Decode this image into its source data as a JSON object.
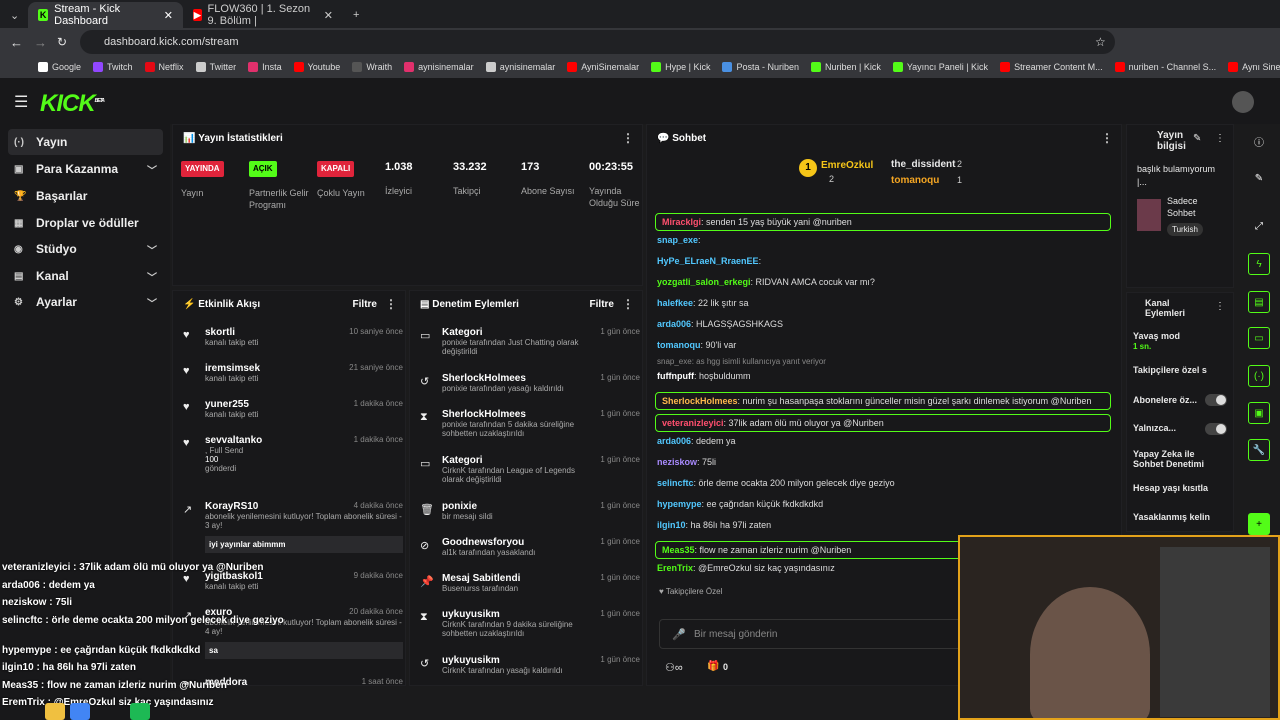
{
  "browser": {
    "tabs": [
      "Stream - Kick Dashboard",
      "FLOW360 | 1. Sezon 9. Bölüm |"
    ],
    "url": "dashboard.kick.com/stream",
    "bookmarks": [
      "Google",
      "Twitch",
      "Netflix",
      "Twitter",
      "Insta",
      "Youtube",
      "Wraith",
      "aynisinemalar",
      "aynisinemalar",
      "AyniSinemalar",
      "Hype | Kick",
      "Posta - Nuriben",
      "Nuriben | Kick",
      "Yayıncı Paneli | Kick",
      "Streamer Content M...",
      "nuriben - Channel S...",
      "Aynı Sinemalar - Ça..."
    ]
  },
  "brand": {
    "logo": "KICK",
    "beta": "BETA"
  },
  "sidebar": [
    "Yayın",
    "Para Kazanma",
    "Başarılar",
    "Droplar ve ödüller",
    "Stüdyo",
    "Kanal",
    "Ayarlar"
  ],
  "stats": {
    "title": "Yayın İstatistikleri",
    "items": [
      {
        "badge": "YAYINDA",
        "label": "Yayın"
      },
      {
        "badge": "AÇIK",
        "label": "Partnerlik Gelir Programı"
      },
      {
        "badge": "KAPALI",
        "label": "Çoklu Yayın"
      },
      {
        "value": "1.038",
        "label": "İzleyici"
      },
      {
        "value": "33.232",
        "label": "Takipçi"
      },
      {
        "value": "173",
        "label": "Abone Sayısı"
      },
      {
        "value": "00:23:55",
        "label": "Yayında Olduğu Süre"
      }
    ]
  },
  "activity": {
    "title": "Etkinlik Akışı",
    "filter": "Filtre",
    "items": [
      {
        "name": "skortli",
        "sub": "kanalı takip etti",
        "time": "10 saniye önce"
      },
      {
        "name": "iremsimsek",
        "sub": "kanalı takip etti",
        "time": "21 saniye önce"
      },
      {
        "name": "yuner255",
        "sub": "kanalı takip etti",
        "time": "1 dakika önce"
      },
      {
        "name": "sevvaltanko",
        "sub": ", Full Send",
        "extra": "100",
        "sub2": "gönderdi",
        "time": "1 dakika önce"
      },
      {
        "name": "KorayRS10",
        "sub": "abonelik yenilemesini kutluyor! Toplam abonelik süresi - 3 ay!",
        "msg": "iyi yayınlar abimmm",
        "time": "4 dakika önce"
      },
      {
        "name": "yigitbaskol1",
        "sub": "kanalı takip etti",
        "time": "9 dakika önce"
      },
      {
        "name": "exuro",
        "sub": "abonelik yenilemesini kutluyor! Toplam abonelik süresi - 4 ay!",
        "msg": "sa",
        "time": "20 dakika önce"
      },
      {
        "name": "meddora",
        "sub": "",
        "time": "1 saat önce"
      }
    ]
  },
  "moderation": {
    "title": "Denetim Eylemleri",
    "filter": "Filtre",
    "items": [
      {
        "name": "Kategori",
        "sub": "ponixie tarafından Just Chatting olarak değiştirildi",
        "time": "1 gün önce"
      },
      {
        "name": "SherlockHolmees",
        "sub": "ponixie tarafından yasağı kaldırıldı",
        "time": "1 gün önce"
      },
      {
        "name": "SherlockHolmees",
        "sub": "ponixie tarafından 5 dakika süreliğine sohbetten uzaklaştırıldı",
        "time": "1 gün önce"
      },
      {
        "name": "Kategori",
        "sub": "CirknK tarafından League of Legends olarak değiştirildi",
        "time": "1 gün önce"
      },
      {
        "name": "ponixie",
        "sub": "bir mesajı sildi",
        "time": "1 gün önce"
      },
      {
        "name": "Goodnewsforyou",
        "sub": "al1k tarafından yasaklandı",
        "time": "1 gün önce"
      },
      {
        "name": "Mesaj Sabitlendi",
        "sub": "Busenurss tarafından",
        "time": "1 gün önce"
      },
      {
        "name": "uykuyusikm",
        "sub": "CirknK tarafından 9 dakika süreliğine sohbetten uzaklaştırıldı",
        "time": "1 gün önce"
      },
      {
        "name": "uykuyusikm",
        "sub": "CirknK tarafından yasağı kaldırıldı",
        "time": "1 gün önce"
      }
    ]
  },
  "chat": {
    "title": "Sohbet",
    "top": [
      {
        "name": "EmreOzkul",
        "n": "2"
      },
      {
        "name": "the_dissident",
        "n": "2"
      },
      {
        "name": "tomanoqu",
        "n": "1"
      }
    ],
    "lines": [
      {
        "u": "Miracklgi",
        "c": "#ff4f6e",
        "m": ": senden 15 yaş büyük yani @nuriben",
        "hl": true
      },
      {
        "u": "snap_exe",
        "c": "#52c8ff",
        "m": ":"
      },
      {
        "u": "HyPe_ELraeN_RraenEE",
        "c": "#52c8ff",
        "m": ":"
      },
      {
        "u": "yozgatli_salon_erkegi",
        "c": "#53fc18",
        "m": ": RIDVAN AMCA cocuk var mı?"
      },
      {
        "u": "halefkee",
        "c": "#52c8ff",
        "m": ": 22 lik şıtır sa"
      },
      {
        "u": "arda006",
        "c": "#52c8ff",
        "m": ": HLAGSŞAGSHKAGS"
      },
      {
        "u": "tomanoqu",
        "c": "#52c8ff",
        "m": ": 90'li var"
      },
      {
        "u": "fuffnpuff",
        "c": "#fff",
        "m": ": hoşbuldumm",
        "reply": "snap_exe: as hgg isimli kullanıcıya yanıt veriyor"
      },
      {
        "u": "SherlockHolmees",
        "c": "#ffb84d",
        "m": ": nurim şu hasanpaşa stoklarını günceller misin güzel şarkı dinlemek istiyorum @Nuriben",
        "hl": true
      },
      {
        "u": "veteranizleyici",
        "c": "#ff4f6e",
        "m": ": 37lik adam ölü mü oluyor ya @Nuriben",
        "hl": true
      },
      {
        "u": "arda006",
        "c": "#52c8ff",
        "m": ": dedem ya"
      },
      {
        "u": "neziskow",
        "c": "#a98bff",
        "m": ": 75li"
      },
      {
        "u": "selincftc",
        "c": "#52c8ff",
        "m": ": örle deme ocakta 200 milyon gelecek diye geziyo"
      },
      {
        "u": "hypemype",
        "c": "#52c8ff",
        "m": ": ee çağrıdan küçük fkdkdkdkd"
      },
      {
        "u": "ilgin10",
        "c": "#52c8ff",
        "m": ": ha 86lı ha 97li zaten"
      },
      {
        "u": "Meas35",
        "c": "#53fc18",
        "m": ": flow ne zaman izleriz nurim @Nuriben",
        "hl": true
      },
      {
        "u": "ErenTrix",
        "c": "#53fc18",
        "m": ": @EmreOzkul siz kaç yaşındasınız"
      }
    ],
    "followers_only": "Takipçilere Özel",
    "placeholder": "Bir mesaj gönderin",
    "count": "0"
  },
  "info": {
    "title": "Yayın bilgisi",
    "name": "başlık bulamıyorum |...",
    "cat": "Sadece Sohbet",
    "lang": "Turkish"
  },
  "channel": {
    "title": "Kanal Eylemleri",
    "items": [
      "Yavaş mod",
      "Takipçilere özel s",
      "Abonelere öz...",
      "Yalnızca...",
      "Yapay Zeka ile Sohbet Denetimi",
      "Hesap yaşı kısıtla",
      "Yasaklanmış kelin"
    ],
    "slow": "1 sn."
  },
  "overlay": [
    "veteranizleyici : 37lik adam ölü mü oluyor ya @Nuriben",
    "arda006 : dedem ya",
    "neziskow : 75li",
    "selincftc : örle deme ocakta 200 milyon gelecek diye geziyo",
    "hypemype : ee çağrıdan küçük fkdkdkdkd",
    "ilgin10 : ha 86lı ha 97li zaten",
    "Meas35 : flow ne zaman izleriz nurim @Nuriben",
    "EremTrix : @EmreOzkul siz kaç yaşındasınız"
  ]
}
